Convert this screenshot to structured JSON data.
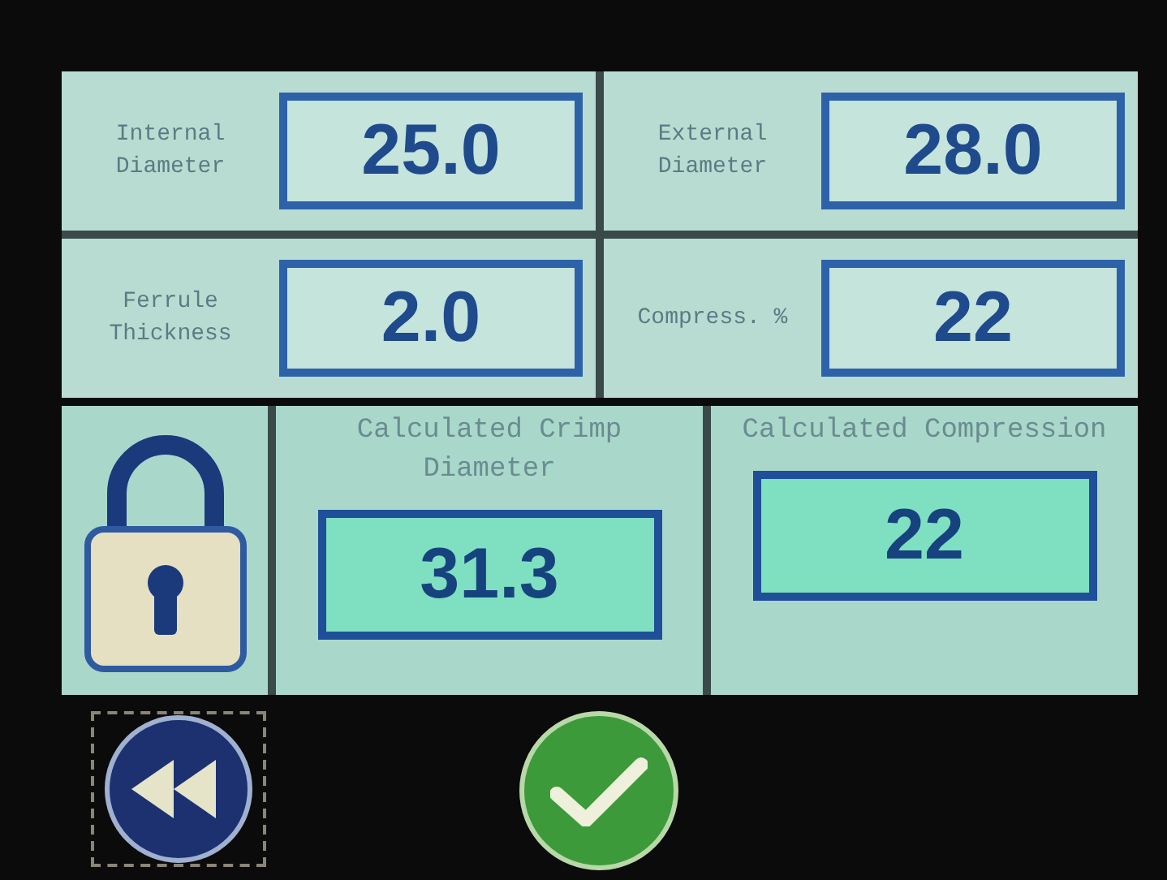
{
  "inputs": [
    {
      "label": "Internal Diameter",
      "value": "25.0"
    },
    {
      "label": "External Diameter",
      "value": "28.0"
    },
    {
      "label": "Ferrule Thickness",
      "value": "2.0"
    },
    {
      "label": "Compress. %",
      "value": "22"
    }
  ],
  "results": [
    {
      "label": "Calculated Crimp Diameter",
      "value": "31.3"
    },
    {
      "label": "Calculated Compression",
      "value": "22"
    }
  ]
}
